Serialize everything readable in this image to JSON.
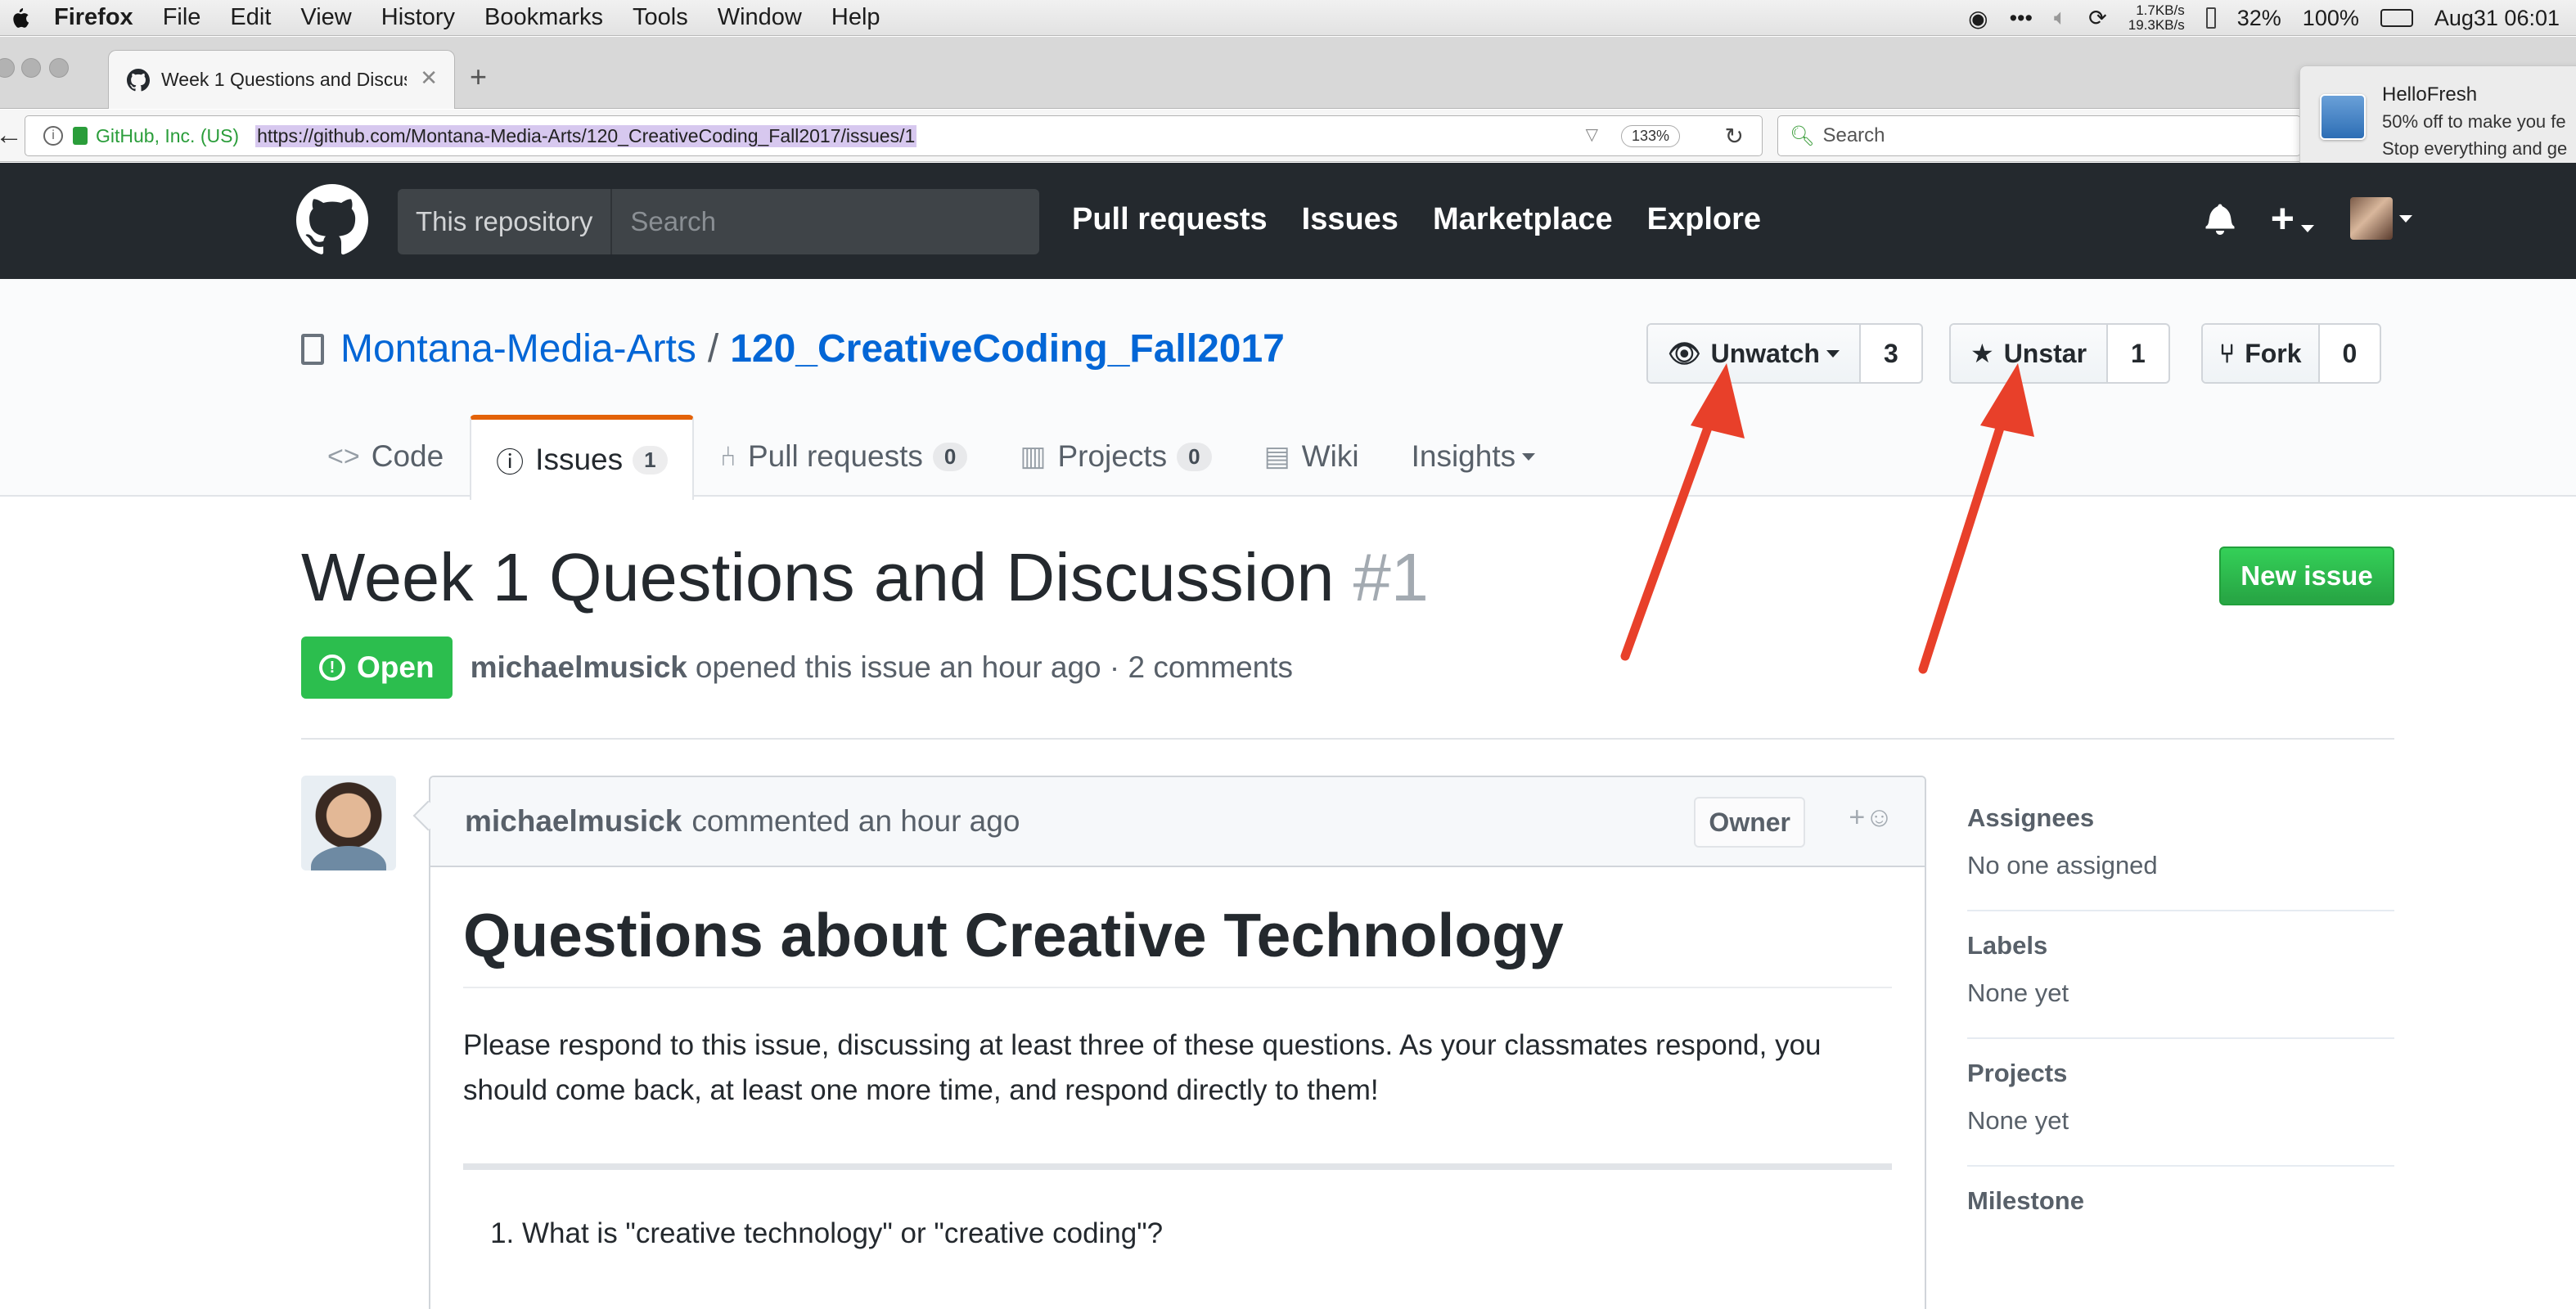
{
  "menubar": {
    "app": "Firefox",
    "items": [
      "File",
      "Edit",
      "View",
      "History",
      "Bookmarks",
      "Tools",
      "Window",
      "Help"
    ],
    "net_up": "1.7KB/s",
    "net_down": "19.3KB/s",
    "battery_low": "32%",
    "battery": "100%",
    "datetime": "Aug31 06:01"
  },
  "browser": {
    "tab_title": "Week 1 Questions and Discus",
    "site_identity": "GitHub, Inc. (US)",
    "url": "https://github.com/Montana-Media-Arts/120_CreativeCoding_Fall2017/issues/1",
    "zoom": "133%",
    "search_placeholder": "Search"
  },
  "notification": {
    "title": "HelloFresh",
    "line1": "50% off to make you fe",
    "line2": "Stop everything and ge"
  },
  "gh_header": {
    "scope_label": "This repository",
    "search_placeholder": "Search",
    "nav": [
      "Pull requests",
      "Issues",
      "Marketplace",
      "Explore"
    ]
  },
  "repo": {
    "owner": "Montana-Media-Arts",
    "separator": "/",
    "name": "120_CreativeCoding_Fall2017",
    "unwatch_label": "Unwatch",
    "watch_count": "3",
    "unstar_label": "Unstar",
    "star_count": "1",
    "fork_label": "Fork",
    "fork_count": "0",
    "tabs": [
      {
        "label": "Code",
        "counter": ""
      },
      {
        "label": "Issues",
        "counter": "1"
      },
      {
        "label": "Pull requests",
        "counter": "0"
      },
      {
        "label": "Projects",
        "counter": "0"
      },
      {
        "label": "Wiki",
        "counter": ""
      },
      {
        "label": "Insights",
        "counter": ""
      }
    ]
  },
  "issue": {
    "title": "Week 1 Questions and Discussion",
    "number": "#1",
    "new_issue_label": "New issue",
    "state": "Open",
    "author": "michaelmusick",
    "meta_text": "opened this issue an hour ago · 2 comments"
  },
  "comment": {
    "author": "michaelmusick",
    "action": "commented an hour ago",
    "owner_badge": "Owner",
    "heading": "Questions about Creative Technology",
    "paragraph": "Please respond to this issue, discussing at least three of these questions. As your classmates respond, you should come back, at least one more time, and respond directly to them!",
    "list": [
      "What is \"creative technology\" or \"creative coding\"?"
    ]
  },
  "sidebar": {
    "assignees_title": "Assignees",
    "assignees_value": "No one assigned",
    "labels_title": "Labels",
    "labels_value": "None yet",
    "projects_title": "Projects",
    "projects_value": "None yet",
    "milestone_title": "Milestone"
  },
  "colors": {
    "accent_link": "#0366d6",
    "open_green": "#2cbe4e",
    "header_dark": "#24292e",
    "annotation_red": "#e8402a",
    "tab_selected_orange": "#e36209"
  }
}
